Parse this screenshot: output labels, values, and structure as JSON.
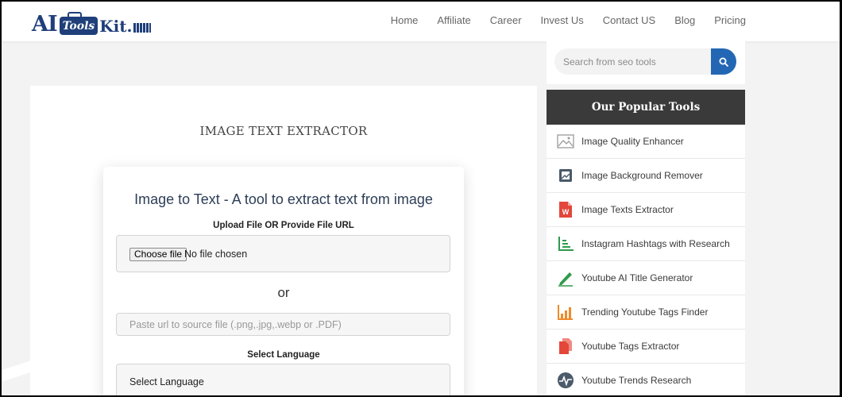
{
  "header": {
    "logo": {
      "part1": "AI",
      "part2": "Tools",
      "part3": "Kit."
    },
    "nav": [
      "Home",
      "Affiliate",
      "Career",
      "Invest Us",
      "Contact US",
      "Blog",
      "Pricing"
    ]
  },
  "main": {
    "page_title": "IMAGE TEXT EXTRACTOR",
    "tool": {
      "heading": "Image to Text - A tool to extract text from image",
      "upload_label": "Upload File OR Provide File URL",
      "choose_file_label": "Choose file",
      "file_status": "No file chosen",
      "or_text": "or",
      "url_placeholder": "Paste url to source file (.png,.jpg,.webp or .PDF)",
      "language_label": "Select Language",
      "language_value": "Select Language"
    }
  },
  "sidebar": {
    "search_placeholder": "Search from seo tools",
    "popular_title": "Our Popular Tools",
    "tools": [
      {
        "label": "Image Quality Enhancer",
        "icon": "image-icon"
      },
      {
        "label": "Image Background Remover",
        "icon": "image-frame-icon"
      },
      {
        "label": "Image Texts Extractor",
        "icon": "word-document-icon"
      },
      {
        "label": "Instagram Hashtags with Research",
        "icon": "chart-axis-icon"
      },
      {
        "label": "Youtube AI Title Generator",
        "icon": "pencil-icon"
      },
      {
        "label": "Trending Youtube Tags Finder",
        "icon": "bar-chart-icon"
      },
      {
        "label": "Youtube Tags Extractor",
        "icon": "document-copy-icon"
      },
      {
        "label": "Youtube Trends Research",
        "icon": "pulse-badge-icon"
      }
    ]
  },
  "colors": {
    "brand": "#1f3f7a",
    "search_button": "#2367b4",
    "popular_header": "#3a3a3a",
    "icon_red": "#e2473a",
    "icon_green": "#2f9a4a",
    "icon_orange": "#ef8a2a"
  }
}
